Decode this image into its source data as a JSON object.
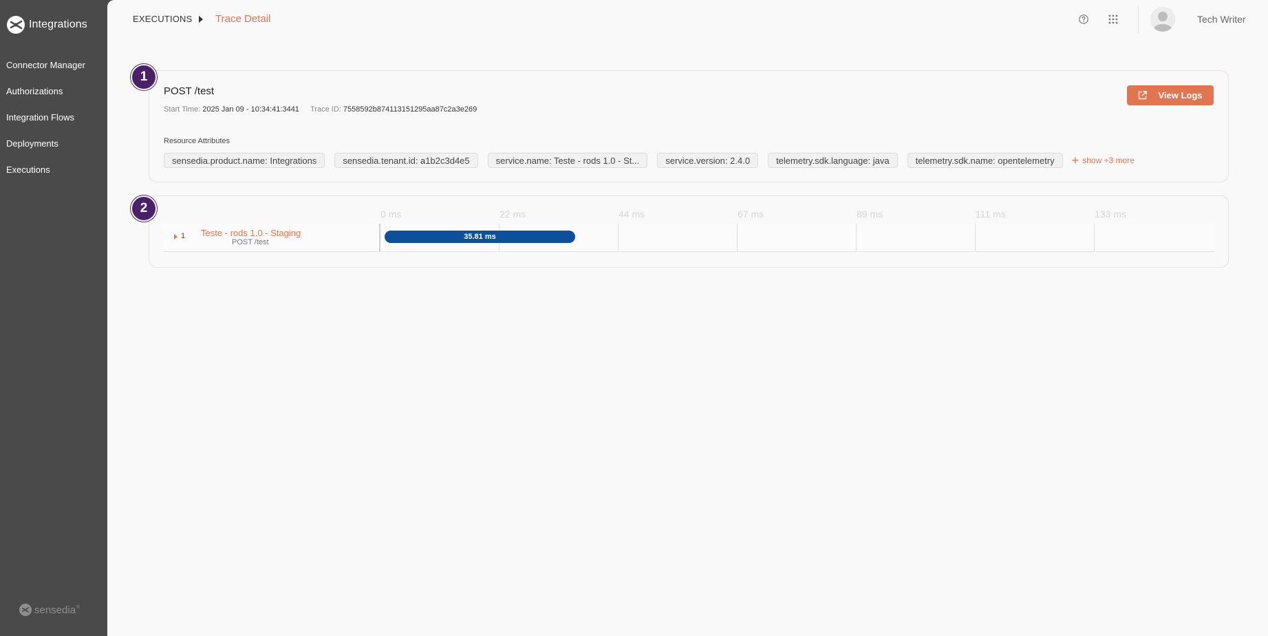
{
  "sidebar": {
    "brand": "Integrations",
    "items": [
      {
        "label": "Connector Manager"
      },
      {
        "label": "Authorizations"
      },
      {
        "label": "Integration Flows"
      },
      {
        "label": "Deployments"
      },
      {
        "label": "Executions"
      }
    ],
    "footer_brand": "sensedia"
  },
  "header": {
    "breadcrumb_root": "EXECUTIONS",
    "breadcrumb_current": "Trace Detail",
    "user_name": "Tech Writer",
    "icons": [
      "help-icon",
      "apps-grid-icon",
      "user-avatar-icon"
    ]
  },
  "steps": [
    "1",
    "2"
  ],
  "trace": {
    "title": "POST /test",
    "start_time_label": "Start Time:",
    "start_time_value": "2025 Jan 09 - 10:34:41:3441",
    "trace_id_label": "Trace ID:",
    "trace_id_value": "7558592b874113151295aa87c2a3e269",
    "view_logs_label": "View Logs",
    "resource_attributes_label": "Resource Attributes",
    "attributes": [
      "sensedia.product.name: Integrations",
      "sensedia.tenant.id: a1b2c3d4e5",
      "service.name: Teste - rods 1.0 - St...",
      "service.version: 2.4.0",
      "telemetry.sdk.language: java",
      "telemetry.sdk.name: opentelemetry"
    ],
    "show_more_label": "show +3 more"
  },
  "timeline": {
    "ticks": [
      "0 ms",
      "22 ms",
      "44 ms",
      "67 ms",
      "89 ms",
      "111 ms",
      "133 ms"
    ],
    "span": {
      "index": "1",
      "service": "Teste - rods 1.0 - Staging",
      "operation": "POST /test",
      "duration_label": "35.81 ms"
    }
  },
  "colors": {
    "sidebar_bg": "#4a4a4a",
    "accent": "#e07650",
    "step_badge": "#4a2169",
    "span_bar": "#0e4f9c"
  }
}
